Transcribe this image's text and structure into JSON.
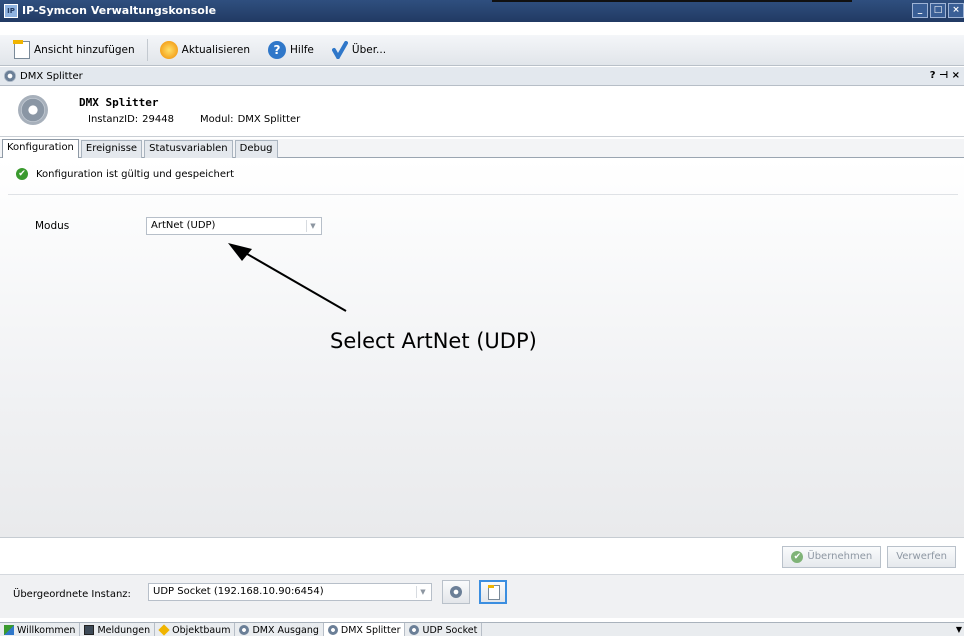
{
  "window": {
    "title": "IP-Symcon Verwaltungskonsole",
    "buttons": [
      "_",
      "□",
      "×"
    ]
  },
  "toolbar": {
    "add_view": "Ansicht hinzufügen",
    "refresh": "Aktualisieren",
    "help": "Hilfe",
    "about": "Über..."
  },
  "panel": {
    "title": "DMX Splitter",
    "controls": "? ⊣ ×"
  },
  "instance": {
    "name": "DMX Splitter",
    "id_label": "InstanzID:",
    "id_value": "29448",
    "module_label": "Modul:",
    "module_value": "DMX Splitter"
  },
  "tabs": [
    "Konfiguration",
    "Ereignisse",
    "Statusvariablen",
    "Debug"
  ],
  "status": {
    "text": "Konfiguration ist gültig und gespeichert",
    "ok_glyph": "✔"
  },
  "form": {
    "modus_label": "Modus",
    "modus_value": "ArtNet (UDP)",
    "arrow_glyph": "▼"
  },
  "annotation": {
    "text": "Select ArtNet (UDP)"
  },
  "actions": {
    "apply": "Übernehmen",
    "discard": "Verwerfen"
  },
  "parent": {
    "label": "Übergeordnete Instanz:",
    "value": "UDP Socket (192.168.10.90:6454)"
  },
  "bottom_tabs": [
    "Willkommen",
    "Meldungen",
    "Objektbaum",
    "DMX Ausgang",
    "DMX Splitter",
    "UDP Socket"
  ],
  "colors": {
    "titlebar": "#2f4f7f",
    "ok_green": "#3a9a2e",
    "focus_blue": "#3b8ee0"
  }
}
